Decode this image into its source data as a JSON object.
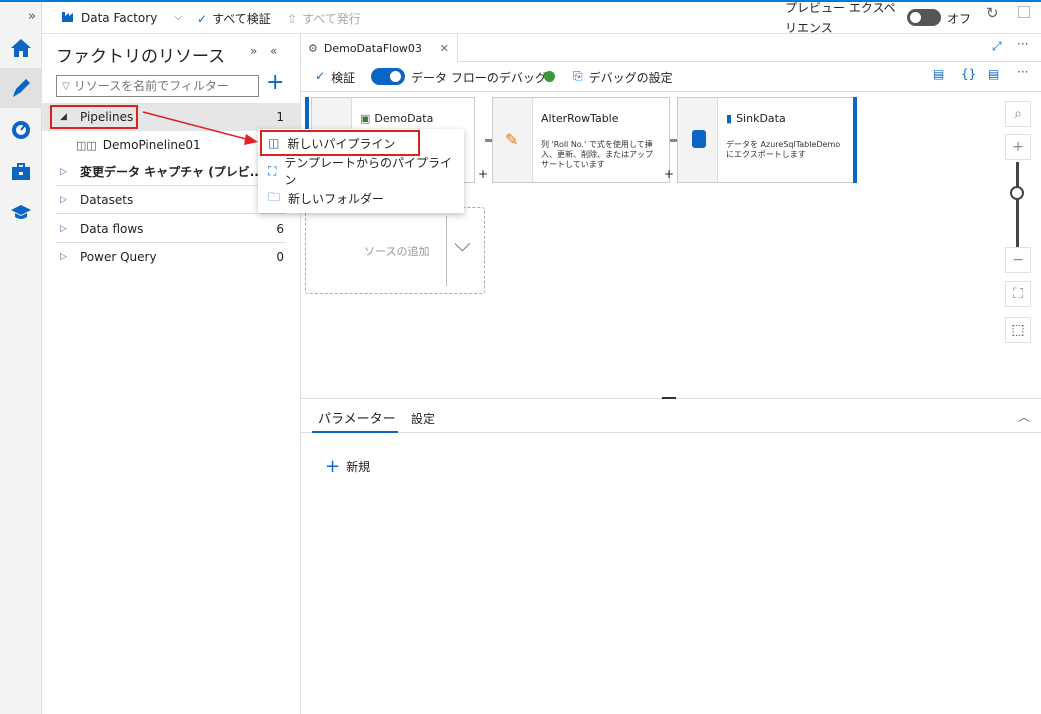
{
  "topbar": {
    "factory_name": "Data Factory",
    "validate_all": "すべて検証",
    "publish_all": "すべて発行",
    "preview_line1": "プレビュー エクスペ",
    "preview_line2": "リエンス",
    "preview_state": "オフ"
  },
  "resources": {
    "title": "ファクトリのリソース",
    "filter_placeholder": "リソースを名前でフィルター",
    "items": [
      {
        "label": "Pipelines",
        "count": "1"
      },
      {
        "label": "DemoPineline01"
      },
      {
        "label": "変更データ キャプチャ (プレビ..."
      },
      {
        "label": "Datasets"
      },
      {
        "label": "Data flows",
        "count": "6"
      },
      {
        "label": "Power Query",
        "count": "0"
      }
    ]
  },
  "context_menu": [
    {
      "label": "新しいパイプライン"
    },
    {
      "label": "テンプレートからのパイプライン"
    },
    {
      "label": "新しいフォルダー"
    }
  ],
  "tab": {
    "label": "DemoDataFlow03"
  },
  "toolbar": {
    "validate": "検証",
    "debug": "データ フローのデバッグ",
    "debug_settings": "デバッグの設定"
  },
  "nodes": [
    {
      "title": "DemoData",
      "desc": ""
    },
    {
      "title": "AlterRowTable",
      "desc": "列 'Roll No.' で式を使用して挿入、更新、削除、またはアップサートしています"
    },
    {
      "title": "SinkData",
      "desc": "データを AzureSqlTableDemo にエクスポートします"
    }
  ],
  "add_source": "ソースの追加",
  "bottom": {
    "tabs": [
      {
        "label": "パラメーター"
      },
      {
        "label": "設定"
      }
    ],
    "new": "新規"
  },
  "colors": {
    "accent": "#0078d4",
    "highlight": "#e02020"
  }
}
